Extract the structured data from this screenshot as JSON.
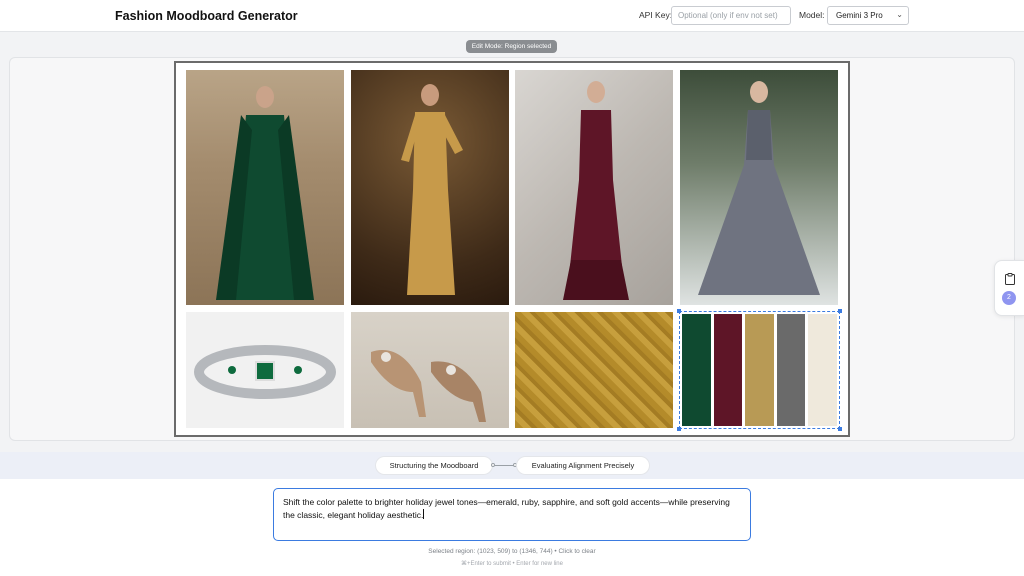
{
  "header": {
    "title": "Fashion Moodboard Generator",
    "api_key_label": "API Key:",
    "api_key_placeholder": "Optional (only if env not set)",
    "model_label": "Model:",
    "model_value": "Gemini 3 Pro"
  },
  "edit_mode": "Edit Mode: Region selected",
  "moodboard": {
    "tiles": [
      {
        "name": "emerald-velvet-gown",
        "icon": "image-icon"
      },
      {
        "name": "gold-sequin-gown",
        "icon": "image-icon"
      },
      {
        "name": "burgundy-ruched-gown",
        "icon": "image-icon"
      },
      {
        "name": "grey-tulle-ballgown",
        "icon": "image-icon"
      },
      {
        "name": "emerald-diamond-bracelet",
        "icon": "image-icon"
      },
      {
        "name": "satin-jeweled-heels",
        "icon": "image-icon"
      },
      {
        "name": "gold-brocade-fabric",
        "icon": "image-icon"
      }
    ],
    "palette": [
      "#0f4a30",
      "#5e1527",
      "#b89a55",
      "#6a6a6a",
      "#efe9dc"
    ]
  },
  "side_tray": {
    "icon": "clipboard-icon",
    "count": "2"
  },
  "progress": {
    "step1": "Structuring the Moodboard",
    "step2": "Evaluating Alignment Precisely"
  },
  "prompt": {
    "text": "Shift the color palette to brighter holiday jewel tones—emerald, ruby, sapphire, and soft gold accents—while preserving the classic, elegant holiday aesthetic."
  },
  "region_hint": "Selected region: (1023, 509) to (1346, 744) • Click to clear",
  "keyboard_hint": "⌘+Enter to submit • Enter for new line",
  "colors": {
    "accent": "#3b7be0",
    "badge": "#8f95f0"
  }
}
